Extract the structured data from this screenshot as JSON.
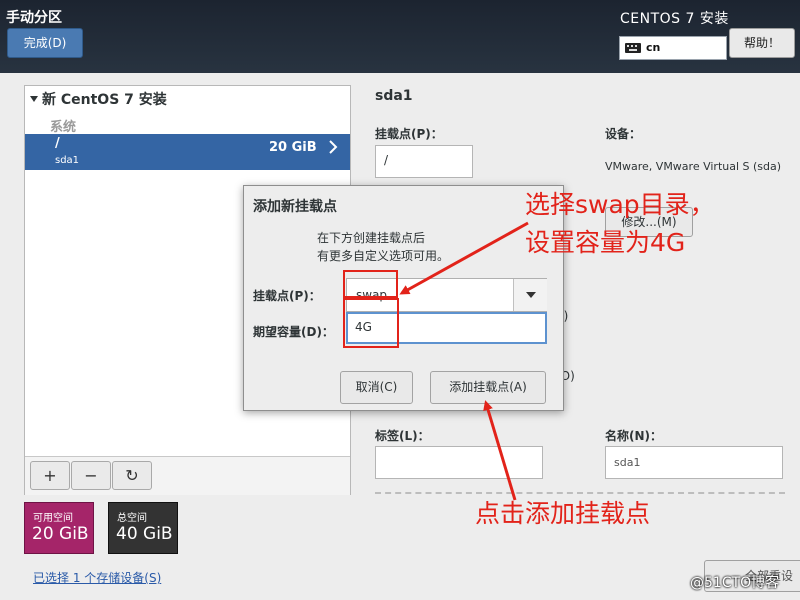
{
  "header": {
    "title": "手动分区",
    "done_button": "完成(D)",
    "product": "CENTOS 7 安装",
    "keyboard_layout": "cn",
    "help_button": "帮助！"
  },
  "left_pane": {
    "install_title": "新 CentOS 7 安装",
    "system_label": "系统",
    "partition": {
      "mount": "/",
      "device": "sda1",
      "size": "20 GiB"
    },
    "toolbar": {
      "add": "+",
      "remove": "−",
      "reload": "↻"
    }
  },
  "space": {
    "available_label": "可用空间",
    "available_value": "20 GiB",
    "total_label": "总空间",
    "total_value": "40 GiB",
    "selected_devices_link": "已选择 1 个存储设备(S)"
  },
  "right_pane": {
    "heading": "sda1",
    "mount_label": "挂载点(P)：",
    "mount_value": "/",
    "device_label": "设备：",
    "device_value": "VMware, VMware Virtual S (sda)",
    "modify_button": "修改...(M)",
    "fragment_e": "E)",
    "fragment_o": "(O)",
    "tag_label": "标签(L)：",
    "name_label": "名称(N)：",
    "name_value": "sda1",
    "reset_button": "全部重设"
  },
  "dialog": {
    "title": "添加新挂载点",
    "desc_line1": "在下方创建挂载点后",
    "desc_line2": "有更多自定义选项可用。",
    "mount_label": "挂载点(P)：",
    "mount_value": "swap",
    "capacity_label": "期望容量(D)：",
    "capacity_value": "4G",
    "cancel_button": "取消(C)",
    "add_button": "添加挂载点(A)"
  },
  "annotations": {
    "text1_line1": "选择swap目录，",
    "text1_line2": "设置容量为4G",
    "text2": "点击添加挂载点",
    "color": "#e2231a"
  },
  "watermark": "@51CTO博客",
  "colors": {
    "header_bg": "#1c2430",
    "selected_row": "#3465a4",
    "available_tile": "#a52569",
    "total_tile": "#333333",
    "done_button": "#4a7ab2"
  }
}
